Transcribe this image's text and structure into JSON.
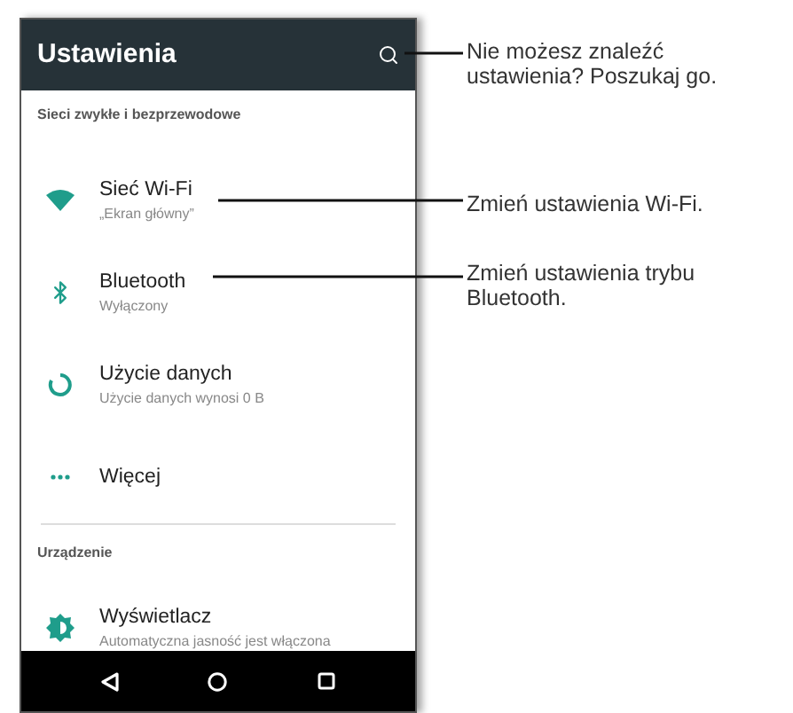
{
  "header": {
    "title": "Ustawienia"
  },
  "sections": [
    {
      "title": "Sieci zwykłe i bezprzewodowe",
      "items": [
        {
          "kind": "wifi",
          "title": "Sieć Wi-Fi",
          "subtitle": "„Ekran główny”"
        },
        {
          "kind": "bluetooth",
          "title": "Bluetooth",
          "subtitle": "Wyłączony"
        },
        {
          "kind": "data",
          "title": "Użycie danych",
          "subtitle": "Użycie danych wynosi 0 B"
        },
        {
          "kind": "more",
          "title": "Więcej"
        }
      ]
    },
    {
      "title": "Urządzenie",
      "items": [
        {
          "kind": "display",
          "title": "Wyświetlacz",
          "subtitle": "Automatyczna jasność jest włączona"
        }
      ]
    }
  ],
  "callouts": [
    "Nie możesz znaleźć ustawienia? Poszukaj go.",
    "Zmień ustawienia Wi-Fi.",
    "Zmień ustawienia trybu Bluetooth."
  ]
}
